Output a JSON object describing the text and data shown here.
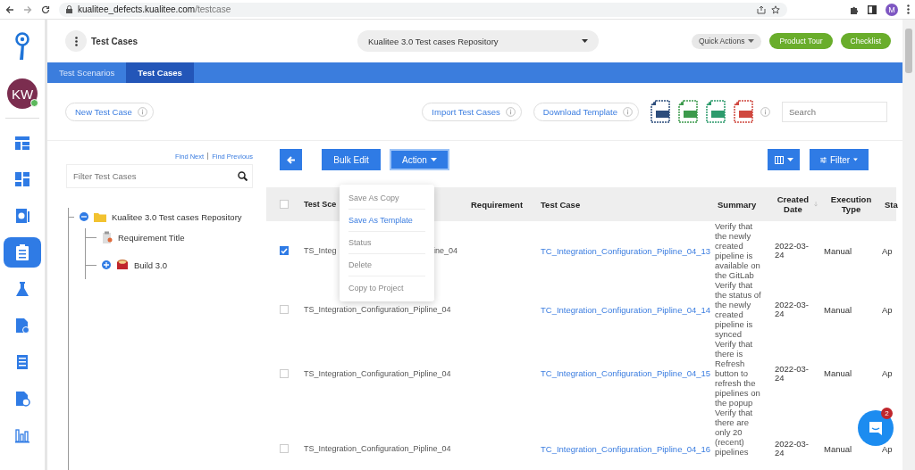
{
  "browser": {
    "url_host": "kualitee_defects.kualitee.com",
    "url_path": "/testcase",
    "profile_initial": "M"
  },
  "sidebar": {
    "avatar": {
      "initials": "KW",
      "online": true
    },
    "items": [
      {
        "selected": false
      },
      {
        "selected": false
      },
      {
        "selected": false
      },
      {
        "selected": true
      },
      {
        "selected": false
      },
      {
        "selected": false
      },
      {
        "selected": false
      },
      {
        "selected": false
      },
      {
        "selected": false
      }
    ]
  },
  "header": {
    "title": "Test Cases",
    "project": "Kualitee 3.0 Test cases Repository",
    "quick_actions": "Quick Actions",
    "buttons": [
      "Product Tour",
      "Checklist"
    ]
  },
  "tabs": [
    {
      "label": "Test Scenarios",
      "selected": false
    },
    {
      "label": "Test Cases",
      "selected": true
    }
  ],
  "toolbar": {
    "new_button": "New Test Case",
    "import_button": "Import Test Cases",
    "download_button": "Download Template",
    "search": {
      "placeholder": "Search"
    }
  },
  "tree_panel": {
    "find_next": "Find Next",
    "find_previous": "Find Previous",
    "filter": {
      "placeholder": "Filter Test Cases"
    },
    "tree": [
      {
        "label": "Kualitee 3.0 Test cases Repository",
        "kind": "folder",
        "expanded": true,
        "children": [
          {
            "label": "Requirement Title",
            "kind": "requirement"
          },
          {
            "label": "Build 3.0",
            "kind": "build",
            "expanded": false
          }
        ]
      }
    ]
  },
  "table_toolbar": {
    "bulk_edit": "Bulk Edit",
    "action": "Action",
    "filter": "Filter"
  },
  "action_menu": {
    "items": [
      {
        "label": "Save As Copy",
        "selected": false
      },
      {
        "label": "Save As Template",
        "selected": true
      },
      {
        "label": "Status",
        "selected": false
      },
      {
        "label": "Delete",
        "selected": false
      },
      {
        "label": "Copy to Project",
        "selected": false
      }
    ]
  },
  "table": {
    "all_selected": false,
    "columns": [
      "Test Sce",
      "Requirement",
      "Test Case",
      "Summary",
      "Created Date",
      "Execution Type",
      "Sta"
    ],
    "rows": [
      {
        "checked": true,
        "scenario": "TS_Integ",
        "scenario_tail": "ine_04",
        "test_case": "TC_Integration_Configuration_Pipline_04_13",
        "summary": "Verify that the newly created pipeline is available on the GitLab",
        "created": "2022-03-24",
        "execution_type": "Manual",
        "status": "Ap"
      },
      {
        "checked": false,
        "scenario": "TS_Integration_Configuration_Pipline_04",
        "test_case": "TC_Integration_Configuration_Pipline_04_14",
        "summary": "Verify that the status of the newly created pipeline is synced",
        "created": "2022-03-24",
        "execution_type": "Manual",
        "status": "Ap"
      },
      {
        "checked": false,
        "scenario": "TS_Integration_Configuration_Pipline_04",
        "test_case": "TC_Integration_Configuration_Pipline_04_15",
        "summary": "Verify that there is Refresh button to refresh the pipelines on the popup",
        "created": "2022-03-24",
        "execution_type": "Manual",
        "status": "Ap"
      },
      {
        "checked": false,
        "scenario": "TS_Integration_Configuration_Pipline_04",
        "test_case": "TC_Integration_Configuration_Pipline_04_16",
        "summary": "Verify that there are only 20 (recent) pipelines",
        "created": "2022-03-24",
        "execution_type": "Manual",
        "status": "Ap"
      }
    ]
  },
  "chat": {
    "badge": "2"
  }
}
